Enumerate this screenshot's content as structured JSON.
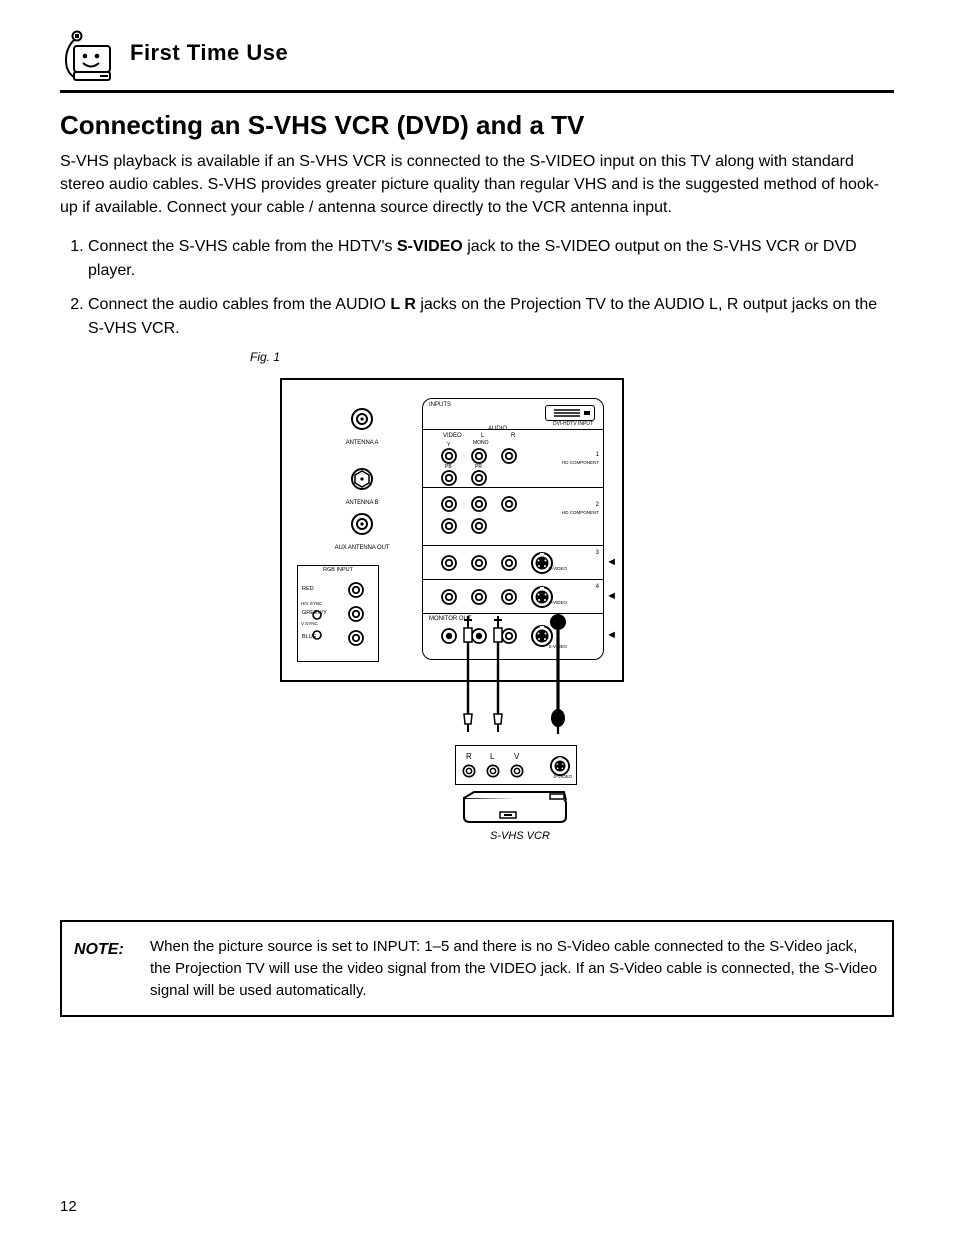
{
  "header": {
    "running": "First Time Use"
  },
  "title": "Connecting an S-VHS VCR (DVD) and a TV",
  "intro": "S-VHS playback is available if an S-VHS VCR is connected to the S-VIDEO input on this TV along with standard stereo audio cables. S-VHS provides greater picture quality than regular VHS and is the suggested method of hook-up if available. Connect your cable / antenna source directly to the VCR antenna input.",
  "steps": {
    "s1a": "Connect the S-VHS cable from the HDTV's ",
    "s1b": "S-VIDEO",
    "s1c": " jack to the S-VIDEO output on the S-VHS VCR or DVD player.",
    "s2a": "Connect the audio cables from the AUDIO ",
    "s2b": "L R",
    "s2c": " jacks on the Projection TV to the AUDIO L, R output jacks on the S-VHS VCR."
  },
  "figure": {
    "caption": "Fig. 1",
    "antenna": {
      "a": "ANTENNA A",
      "b": "ANTENNA B",
      "out": "AUX ANTENNA OUT"
    },
    "rgb": {
      "title": "RGB INPUT",
      "sync": "H/V SYNC",
      "v": "V SYNC",
      "r": "RED",
      "g": "GREEN/Y",
      "b": "BLUE"
    },
    "panel": {
      "label_inputs": "INPUTS",
      "col_video": "VIDEO",
      "col_l": "L",
      "col_r": "R",
      "col_audio": "AUDIO",
      "col_mono": "MONO",
      "dvi": "DVI-HDTV INPUT",
      "row1": "1",
      "row1_hd": "HD COMPONENT",
      "row1_y": "Y",
      "row1_pb": "PB",
      "row1_pr": "PR",
      "row2": "2",
      "row2_hd": "HD COMPONENT",
      "row3": "3",
      "row3_sv": "S-VIDEO",
      "row4": "4",
      "row4_sv": "S-VIDEO",
      "row5_out": "MONITOR OUT",
      "row5_sv": "S-VIDEO",
      "in4_arrow": "◄",
      "out_arrow": "◄",
      "svhs3_arrow": "◄"
    },
    "ext": {
      "r": "R",
      "l": "L",
      "v": "V",
      "sv": "S-VIDEO"
    },
    "device": "S-VHS VCR"
  },
  "note": {
    "label": "NOTE:",
    "body": "When the picture source is set to INPUT: 1–5 and there is no S-Video cable connected to the S-Video jack, the Projection TV will use the video signal from the VIDEO jack. If an S-Video cable is connected, the S-Video signal will be used automatically."
  },
  "pagenum": "12"
}
